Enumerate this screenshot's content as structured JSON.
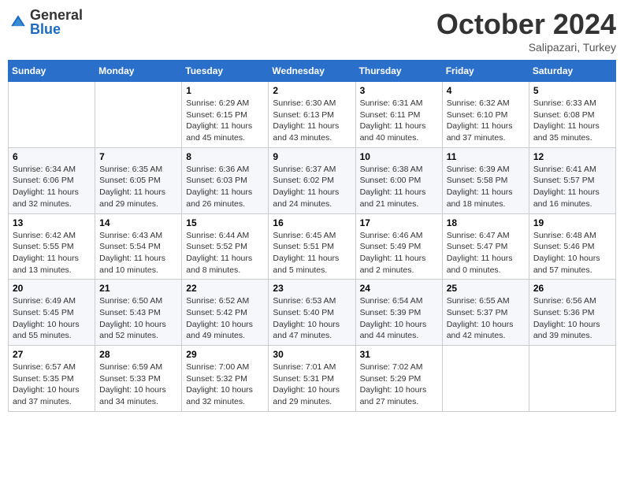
{
  "header": {
    "logo_general": "General",
    "logo_blue": "Blue",
    "month": "October 2024",
    "location": "Salipazari, Turkey"
  },
  "weekdays": [
    "Sunday",
    "Monday",
    "Tuesday",
    "Wednesday",
    "Thursday",
    "Friday",
    "Saturday"
  ],
  "weeks": [
    [
      null,
      null,
      {
        "day": 1,
        "sunrise": "Sunrise: 6:29 AM",
        "sunset": "Sunset: 6:15 PM",
        "daylight": "Daylight: 11 hours and 45 minutes."
      },
      {
        "day": 2,
        "sunrise": "Sunrise: 6:30 AM",
        "sunset": "Sunset: 6:13 PM",
        "daylight": "Daylight: 11 hours and 43 minutes."
      },
      {
        "day": 3,
        "sunrise": "Sunrise: 6:31 AM",
        "sunset": "Sunset: 6:11 PM",
        "daylight": "Daylight: 11 hours and 40 minutes."
      },
      {
        "day": 4,
        "sunrise": "Sunrise: 6:32 AM",
        "sunset": "Sunset: 6:10 PM",
        "daylight": "Daylight: 11 hours and 37 minutes."
      },
      {
        "day": 5,
        "sunrise": "Sunrise: 6:33 AM",
        "sunset": "Sunset: 6:08 PM",
        "daylight": "Daylight: 11 hours and 35 minutes."
      }
    ],
    [
      {
        "day": 6,
        "sunrise": "Sunrise: 6:34 AM",
        "sunset": "Sunset: 6:06 PM",
        "daylight": "Daylight: 11 hours and 32 minutes."
      },
      {
        "day": 7,
        "sunrise": "Sunrise: 6:35 AM",
        "sunset": "Sunset: 6:05 PM",
        "daylight": "Daylight: 11 hours and 29 minutes."
      },
      {
        "day": 8,
        "sunrise": "Sunrise: 6:36 AM",
        "sunset": "Sunset: 6:03 PM",
        "daylight": "Daylight: 11 hours and 26 minutes."
      },
      {
        "day": 9,
        "sunrise": "Sunrise: 6:37 AM",
        "sunset": "Sunset: 6:02 PM",
        "daylight": "Daylight: 11 hours and 24 minutes."
      },
      {
        "day": 10,
        "sunrise": "Sunrise: 6:38 AM",
        "sunset": "Sunset: 6:00 PM",
        "daylight": "Daylight: 11 hours and 21 minutes."
      },
      {
        "day": 11,
        "sunrise": "Sunrise: 6:39 AM",
        "sunset": "Sunset: 5:58 PM",
        "daylight": "Daylight: 11 hours and 18 minutes."
      },
      {
        "day": 12,
        "sunrise": "Sunrise: 6:41 AM",
        "sunset": "Sunset: 5:57 PM",
        "daylight": "Daylight: 11 hours and 16 minutes."
      }
    ],
    [
      {
        "day": 13,
        "sunrise": "Sunrise: 6:42 AM",
        "sunset": "Sunset: 5:55 PM",
        "daylight": "Daylight: 11 hours and 13 minutes."
      },
      {
        "day": 14,
        "sunrise": "Sunrise: 6:43 AM",
        "sunset": "Sunset: 5:54 PM",
        "daylight": "Daylight: 11 hours and 10 minutes."
      },
      {
        "day": 15,
        "sunrise": "Sunrise: 6:44 AM",
        "sunset": "Sunset: 5:52 PM",
        "daylight": "Daylight: 11 hours and 8 minutes."
      },
      {
        "day": 16,
        "sunrise": "Sunrise: 6:45 AM",
        "sunset": "Sunset: 5:51 PM",
        "daylight": "Daylight: 11 hours and 5 minutes."
      },
      {
        "day": 17,
        "sunrise": "Sunrise: 6:46 AM",
        "sunset": "Sunset: 5:49 PM",
        "daylight": "Daylight: 11 hours and 2 minutes."
      },
      {
        "day": 18,
        "sunrise": "Sunrise: 6:47 AM",
        "sunset": "Sunset: 5:47 PM",
        "daylight": "Daylight: 11 hours and 0 minutes."
      },
      {
        "day": 19,
        "sunrise": "Sunrise: 6:48 AM",
        "sunset": "Sunset: 5:46 PM",
        "daylight": "Daylight: 10 hours and 57 minutes."
      }
    ],
    [
      {
        "day": 20,
        "sunrise": "Sunrise: 6:49 AM",
        "sunset": "Sunset: 5:45 PM",
        "daylight": "Daylight: 10 hours and 55 minutes."
      },
      {
        "day": 21,
        "sunrise": "Sunrise: 6:50 AM",
        "sunset": "Sunset: 5:43 PM",
        "daylight": "Daylight: 10 hours and 52 minutes."
      },
      {
        "day": 22,
        "sunrise": "Sunrise: 6:52 AM",
        "sunset": "Sunset: 5:42 PM",
        "daylight": "Daylight: 10 hours and 49 minutes."
      },
      {
        "day": 23,
        "sunrise": "Sunrise: 6:53 AM",
        "sunset": "Sunset: 5:40 PM",
        "daylight": "Daylight: 10 hours and 47 minutes."
      },
      {
        "day": 24,
        "sunrise": "Sunrise: 6:54 AM",
        "sunset": "Sunset: 5:39 PM",
        "daylight": "Daylight: 10 hours and 44 minutes."
      },
      {
        "day": 25,
        "sunrise": "Sunrise: 6:55 AM",
        "sunset": "Sunset: 5:37 PM",
        "daylight": "Daylight: 10 hours and 42 minutes."
      },
      {
        "day": 26,
        "sunrise": "Sunrise: 6:56 AM",
        "sunset": "Sunset: 5:36 PM",
        "daylight": "Daylight: 10 hours and 39 minutes."
      }
    ],
    [
      {
        "day": 27,
        "sunrise": "Sunrise: 6:57 AM",
        "sunset": "Sunset: 5:35 PM",
        "daylight": "Daylight: 10 hours and 37 minutes."
      },
      {
        "day": 28,
        "sunrise": "Sunrise: 6:59 AM",
        "sunset": "Sunset: 5:33 PM",
        "daylight": "Daylight: 10 hours and 34 minutes."
      },
      {
        "day": 29,
        "sunrise": "Sunrise: 7:00 AM",
        "sunset": "Sunset: 5:32 PM",
        "daylight": "Daylight: 10 hours and 32 minutes."
      },
      {
        "day": 30,
        "sunrise": "Sunrise: 7:01 AM",
        "sunset": "Sunset: 5:31 PM",
        "daylight": "Daylight: 10 hours and 29 minutes."
      },
      {
        "day": 31,
        "sunrise": "Sunrise: 7:02 AM",
        "sunset": "Sunset: 5:29 PM",
        "daylight": "Daylight: 10 hours and 27 minutes."
      },
      null,
      null
    ]
  ]
}
